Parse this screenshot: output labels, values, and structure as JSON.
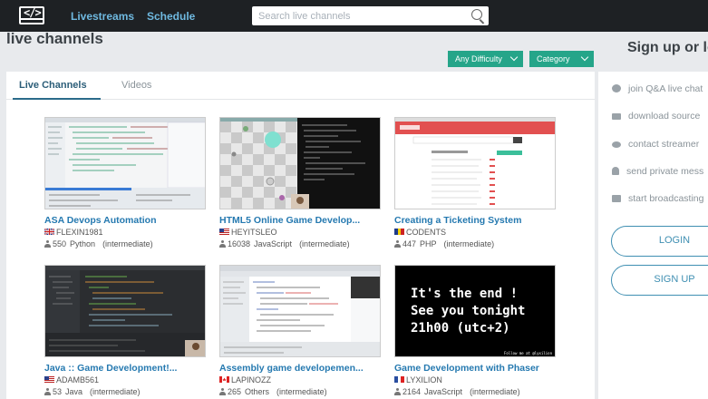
{
  "navbar": {
    "logo": "</>",
    "links": [
      "Livestreams",
      "Schedule"
    ],
    "search_placeholder": "Search live channels"
  },
  "page": {
    "title": "live channels",
    "filters": [
      "Any Difficulty",
      "Category"
    ]
  },
  "tabs": [
    {
      "label": "Live Channels",
      "active": true
    },
    {
      "label": "Videos",
      "active": false
    }
  ],
  "channels": [
    {
      "title": "ASA Devops Automation",
      "user": "FLEXIN1981",
      "flag": "uk",
      "viewers": "550",
      "category": "Python",
      "level": "(intermediate)"
    },
    {
      "title": "HTML5 Online Game Develop...",
      "user": "HEYITSLEO",
      "flag": "us",
      "viewers": "16038",
      "category": "JavaScript",
      "level": "(intermediate)"
    },
    {
      "title": "Creating a Ticketing System",
      "user": "CODENTS",
      "flag": "ro",
      "viewers": "447",
      "category": "PHP",
      "level": "(intermediate)"
    },
    {
      "title": "Java :: Game Development!...",
      "user": "ADAMB561",
      "flag": "us",
      "viewers": "53",
      "category": "Java",
      "level": "(intermediate)"
    },
    {
      "title": "Assembly game developemen...",
      "user": "LAPINOZZ",
      "flag": "ca",
      "viewers": "265",
      "category": "Others",
      "level": "(intermediate)"
    },
    {
      "title": "Game Development with Phaser",
      "user": "LYXILION",
      "flag": "fr",
      "viewers": "2164",
      "category": "JavaScript",
      "level": "(intermediate)"
    }
  ],
  "thumb_text": {
    "phaser_lines": [
      "It's the end !",
      "See you tonight",
      "21h00 (utc+2)"
    ],
    "phaser_caption": "Follow me at @lyxilion"
  },
  "sidebar": {
    "title": "Sign up or lo",
    "features": [
      {
        "icon": "chat-icon",
        "label": "join Q&A live chat"
      },
      {
        "icon": "envelope-icon",
        "label": "download source"
      },
      {
        "icon": "eye-icon",
        "label": "contact streamer"
      },
      {
        "icon": "user-icon",
        "label": "send private mess"
      },
      {
        "icon": "video-camera-icon",
        "label": "start broadcasting"
      }
    ],
    "login_label": "LOGIN",
    "signup_label": "SIGN UP"
  },
  "colors": {
    "navbar": "#1e2124",
    "nav_link": "#6fb9e0",
    "filter": "#25a589",
    "title_link": "#2579b0",
    "button_border": "#3f8fb2"
  }
}
